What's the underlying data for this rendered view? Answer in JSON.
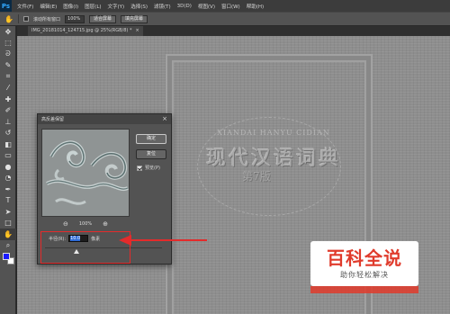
{
  "app": {
    "logo": "Ps"
  },
  "menu": [
    "文件(F)",
    "编辑(E)",
    "图像(I)",
    "图层(L)",
    "文字(Y)",
    "选择(S)",
    "滤镜(T)",
    "3D(D)",
    "视图(V)",
    "窗口(W)",
    "帮助(H)"
  ],
  "options": {
    "scroll_all_label": "滚动所有窗口",
    "zoom_value": "100%",
    "fit_screen_label": "适合屏幕",
    "fill_screen_label": "填充屏幕"
  },
  "document": {
    "tab_title": "IMG_20181014_124715.jpg @ 25%(RGB/8) *",
    "tab_close": "×"
  },
  "canvas": {
    "pinyin": "XIANDAI HANYU CIDIAN",
    "title": "现代汉语词典",
    "edition": "第7版"
  },
  "dialog": {
    "title": "高反差保留",
    "close": "×",
    "ok_label": "确定",
    "reset_label": "复位",
    "preview_label": "预览(P)",
    "preview_checked": true,
    "zoom_out": "⊖",
    "zoom_level": "100%",
    "zoom_in": "⊕",
    "radius_label": "半径(R):",
    "radius_value": "10.0",
    "radius_unit": "像素",
    "radius_slider_fraction": 0.27
  },
  "colors": {
    "foreground": "#1a1aff",
    "background": "#ffffff",
    "annotation": "#e42b2b",
    "watermark_red": "#e03b2c"
  },
  "watermark": {
    "main": "百科全说",
    "sub": "助你轻松解决"
  },
  "tools": [
    "move-icon",
    "marquee-icon",
    "lasso-icon",
    "quick-select-icon",
    "crop-icon",
    "eyedropper-icon",
    "healing-icon",
    "brush-icon",
    "stamp-icon",
    "history-brush-icon",
    "eraser-icon",
    "gradient-icon",
    "blur-icon",
    "dodge-icon",
    "pen-icon",
    "type-icon",
    "path-select-icon",
    "rectangle-icon",
    "hand-icon",
    "zoom-icon"
  ]
}
